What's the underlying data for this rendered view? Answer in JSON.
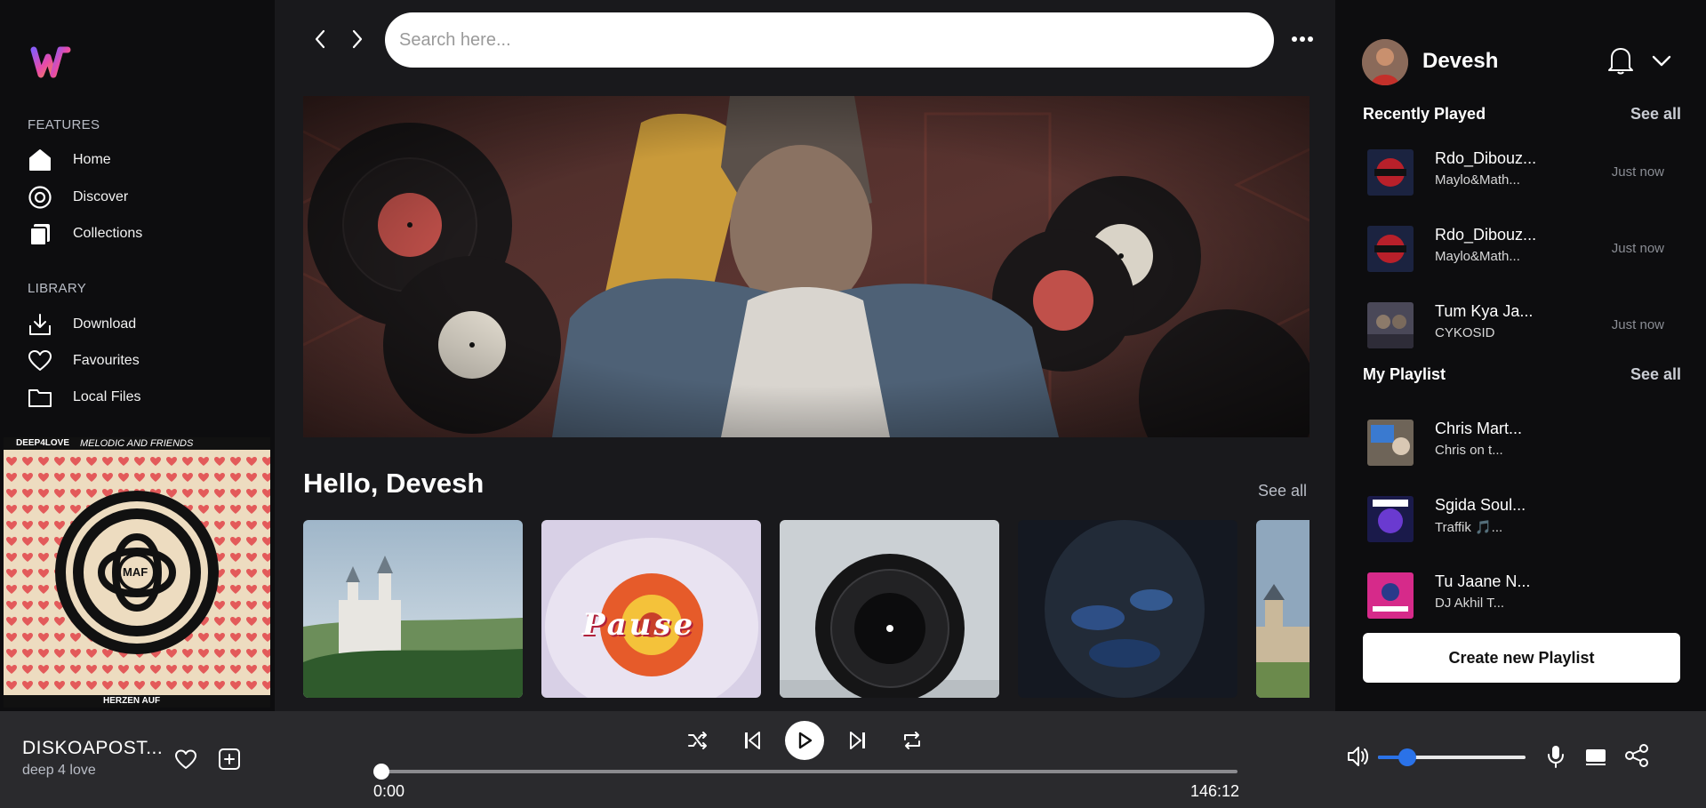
{
  "sidebar": {
    "features_title": "FEATURES",
    "library_title": "LIBRARY",
    "features": [
      {
        "label": "Home",
        "icon": "home-icon"
      },
      {
        "label": "Discover",
        "icon": "discover-icon"
      },
      {
        "label": "Collections",
        "icon": "collections-icon"
      }
    ],
    "library": [
      {
        "label": "Download",
        "icon": "download-icon"
      },
      {
        "label": "Favourites",
        "icon": "heart-icon"
      },
      {
        "label": "Local Files",
        "icon": "folder-icon"
      }
    ],
    "album_art": {
      "top_left": "DEEP4LOVE",
      "top_right": "MELODIC AND FRIENDS",
      "center": "MAF",
      "bottom": "HERZEN AUF"
    }
  },
  "search": {
    "placeholder": "Search here..."
  },
  "main": {
    "greeting": "Hello, Devesh",
    "see_all": "See all",
    "cards": [
      {
        "name": "castle",
        "text": ""
      },
      {
        "name": "pause",
        "text": "Pause"
      },
      {
        "name": "lens",
        "text": ""
      },
      {
        "name": "dark",
        "text": ""
      },
      {
        "name": "palace",
        "text": ""
      }
    ]
  },
  "right": {
    "username": "Devesh",
    "recently_played_title": "Recently Played",
    "my_playlist_title": "My Playlist",
    "see_all": "See all",
    "recent": [
      {
        "title": "Rdo_Dibouz...",
        "artist": "Maylo&Math...",
        "time": "Just now"
      },
      {
        "title": "Rdo_Dibouz...",
        "artist": "Maylo&Math...",
        "time": "Just now"
      },
      {
        "title": "Tum Kya Ja...",
        "artist": "CYKOSID",
        "time": "Just now"
      }
    ],
    "playlists": [
      {
        "title": "Chris Mart...",
        "artist": "Chris on t..."
      },
      {
        "title": "Sgida Soul...",
        "artist": "Traffik 🎵..."
      },
      {
        "title": "Tu Jaane N...",
        "artist": "DJ Akhil T..."
      }
    ],
    "create_button": "Create new Playlist"
  },
  "player": {
    "title": "DISKOAPOST...",
    "artist": "deep 4 love",
    "current_time": "0:00",
    "total_time": "146:12",
    "progress": 0,
    "volume": 0.2
  },
  "colors": {
    "accent_blue": "#2a72e8",
    "background": "#0d0d0f",
    "main_bg": "#19191c",
    "player_bg": "#2a2a2d"
  }
}
